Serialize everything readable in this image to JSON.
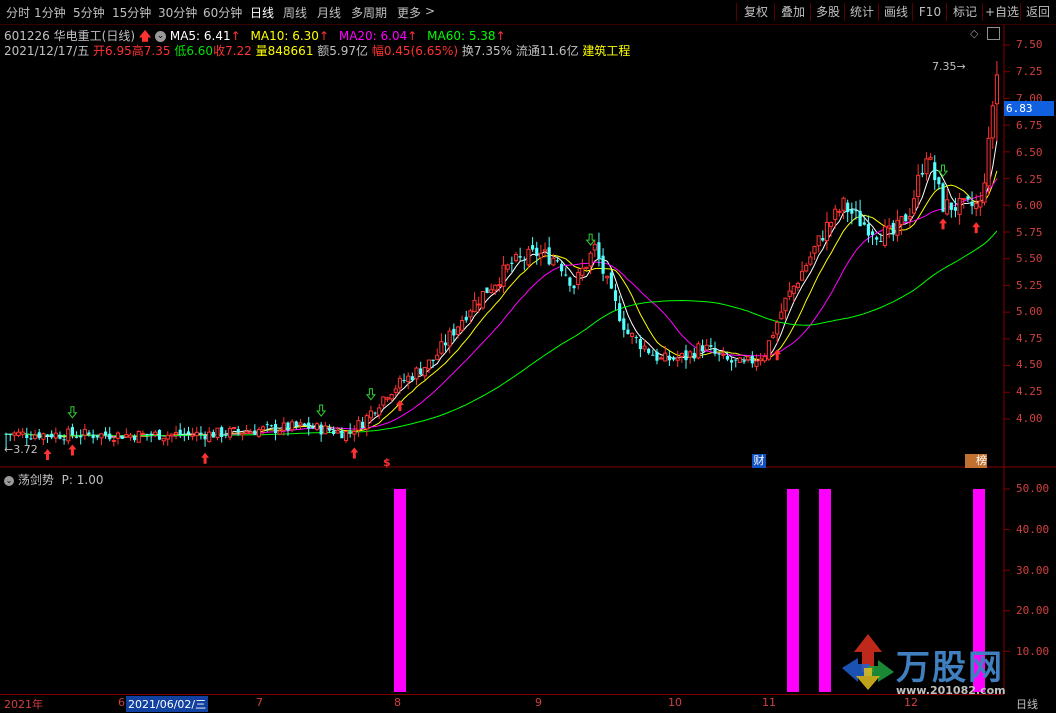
{
  "toolbar": {
    "periods": [
      "分时",
      "1分钟",
      "5分钟",
      "15分钟",
      "30分钟",
      "60分钟",
      "日线",
      "周线",
      "月线",
      "多周期",
      "更多"
    ],
    "active_period": "日线",
    "more_chevron": ">",
    "buttons": [
      "复权",
      "叠加",
      "多股",
      "统计",
      "画线",
      "F10",
      "标记",
      "+自选",
      "返回"
    ]
  },
  "stock": {
    "code": "601226",
    "name": "华电重工",
    "period_label": "(日线)",
    "ma5": "MA5: 6.41",
    "ma10": "MA10: 6.30",
    "ma20": "MA20: 6.04",
    "ma60": "MA60: 5.38",
    "date": "2021/12/17/五",
    "open": "开6.95",
    "high": "高7.35",
    "low": "低6.60",
    "close": "收7.22",
    "volume": "量848661",
    "amount": "额5.97亿",
    "change": "幅0.45(6.65%)",
    "turnover": "换7.35%",
    "float_cap": "流通11.6亿",
    "sector": "建筑工程"
  },
  "price_axis": {
    "ticks": [
      "7.50",
      "7.25",
      "7.00",
      "6.75",
      "6.50",
      "6.25",
      "6.00",
      "5.75",
      "5.50",
      "5.25",
      "5.00",
      "4.75",
      "4.50",
      "4.25",
      "4.00"
    ],
    "current_price": "6.83",
    "high_label": "7.35",
    "low_label": "3.72"
  },
  "markers": {
    "s_marker": "$",
    "cai_marker": "财",
    "rank_marker": "榜"
  },
  "indicator": {
    "title": "荡剑势",
    "param": "P: 1.00",
    "ticks": [
      "50.00",
      "40.00",
      "30.00",
      "20.00",
      "10.00"
    ]
  },
  "date_axis": {
    "labels": [
      "2021年",
      "6",
      "2021/06/02/三",
      "7",
      "8",
      "9",
      "10",
      "11",
      "12"
    ],
    "right_label": "日线"
  },
  "watermark": {
    "name": "万股网",
    "url": "www.201082.com"
  },
  "colors": {
    "bg": "#000000",
    "up": "#ff3232",
    "down": "#54ffff",
    "ma5": "#ffffff",
    "ma10": "#ffff00",
    "ma20": "#ff00ff",
    "ma60": "#00ff00",
    "bar": "#ff00ff",
    "axis": "#800000"
  },
  "chart_data": {
    "type": "candlestick",
    "indicator_bars": [
      {
        "date": "2021-08-02",
        "value": 50
      },
      {
        "date": "2021-11-11",
        "value": 50
      },
      {
        "date": "2021-11-22",
        "value": 50
      },
      {
        "date": "2021-12-17",
        "value": 50
      }
    ],
    "ma_values": {
      "MA5": 6.41,
      "MA10": 6.3,
      "MA20": 6.04,
      "MA60": 5.38
    },
    "last_bar": {
      "open": 6.95,
      "high": 7.35,
      "low": 6.6,
      "close": 7.22
    },
    "ylim": [
      3.7,
      7.6
    ],
    "indicator_ylim": [
      0,
      55
    ]
  }
}
